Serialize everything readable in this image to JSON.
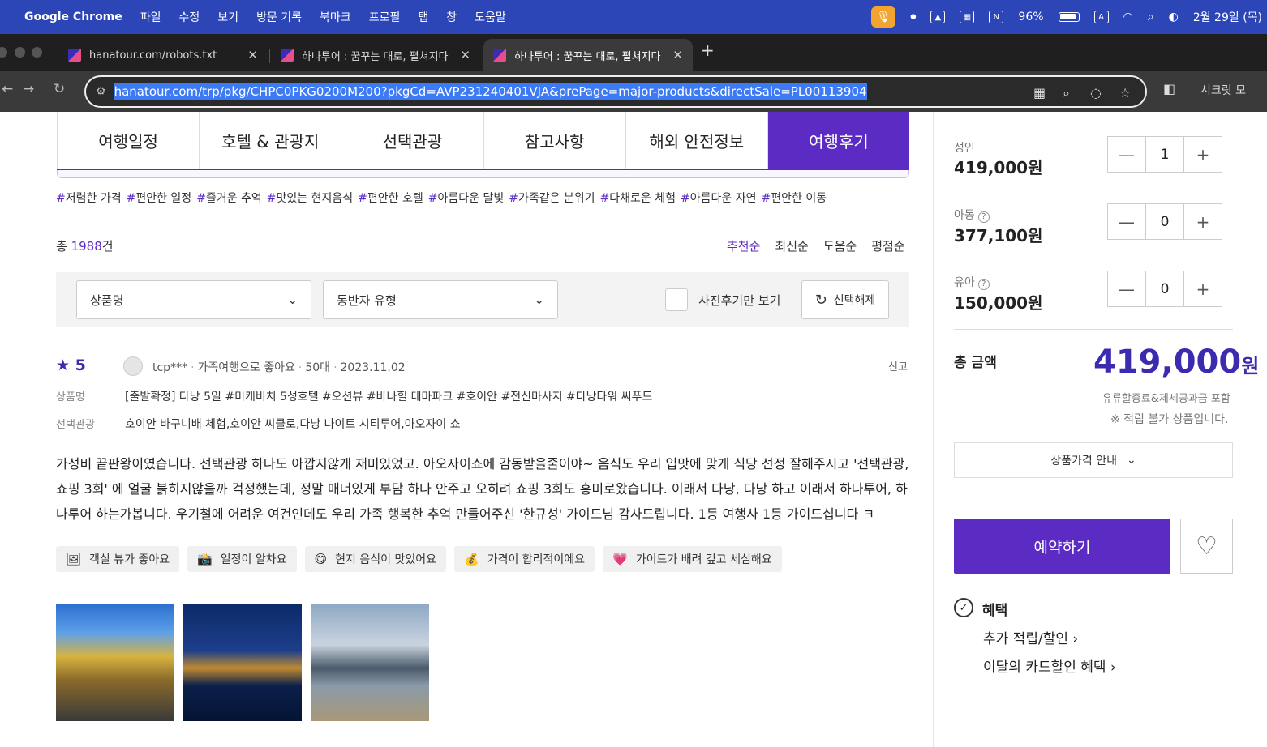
{
  "menubar": {
    "app": "Google Chrome",
    "items": [
      "파일",
      "수정",
      "보기",
      "방문 기록",
      "북마크",
      "프로필",
      "탭",
      "창",
      "도움말"
    ],
    "battery": "96%",
    "input_mode": "A",
    "datetime": "2월 29일 (목)"
  },
  "tabs": [
    {
      "title": "hanatour.com/robots.txt"
    },
    {
      "title": "하나투어 : 꿈꾸는 대로, 펼쳐지다"
    },
    {
      "title": "하나투어 : 꿈꾸는 대로, 펼쳐지다"
    }
  ],
  "address": {
    "url": "hanatour.com/trp/pkg/CHPC0PKG0200M200?pkgCd=AVP231240401VJA&prePage=major-products&directSale=PL00113904",
    "incognito_label": "시크릿 모"
  },
  "nav": [
    "여행일정",
    "호텔 & 관광지",
    "선택관광",
    "참고사항",
    "해외 안전정보",
    "여행후기"
  ],
  "tags": [
    "저렴한 가격",
    "편안한 일정",
    "즐거운 추억",
    "맛있는 현지음식",
    "편안한 호텔",
    "아름다운 달빛",
    "가족같은 분위기",
    "다채로운 체험",
    "아름다운 자연",
    "편안한 이동"
  ],
  "summary": {
    "total_prefix": "총 ",
    "total_count": "1988",
    "total_suffix": "건"
  },
  "sorts": [
    "추천순",
    "최신순",
    "도움순",
    "평점순"
  ],
  "filters": {
    "product": "상품명",
    "companion": "동반자 유형",
    "photo_only": "사진후기만 보기",
    "reset": "선택해제"
  },
  "review": {
    "rating": "5",
    "user": "tcp***",
    "type": "가족여행으로 좋아요",
    "age": "50대",
    "date": "2023.11.02",
    "report": "신고",
    "product_label": "상품명",
    "product": "[출발확정] 다낭 5일 #미케비치 5성호텔 #오션뷰 #바나힐 테마파크 #호이안 #전신마사지 #다낭타워 씨푸드",
    "option_label": "선택관광",
    "option": "호이안 바구니배 체험,호이안 씨클로,다낭 나이트 시티투어,아오자이 쇼",
    "text": "가성비 끝판왕이였습니다. 선택관광 하나도 아깝지않게 재미있었고. 아오자이쇼에 감동받을줄이야~ 음식도 우리 입맛에 맞게 식당 선정 잘해주시고 '선택관광, 쇼핑 3회' 에 얼굴 붉히지않을까 걱정했는데, 정말 매너있게 부담 하나 안주고 오히려 쇼핑 3회도 흥미로왔습니다. 이래서 다낭, 다낭 하고 이래서 하나투어, 하나투어 하는가봅니다. 우기철에 어려운 여건인데도 우리 가족 행복한 추억 만들어주신 '한규성' 가이드님 감사드립니다. 1등 여행사 1등 가이드십니다 ㅋ",
    "chips": [
      {
        "emoji": "🖼",
        "label": "객실 뷰가 좋아요"
      },
      {
        "emoji": "📸",
        "label": "일정이 알차요"
      },
      {
        "emoji": "😋",
        "label": "현지 음식이 맛있어요"
      },
      {
        "emoji": "💰",
        "label": "가격이 합리적이에요"
      },
      {
        "emoji": "💗",
        "label": "가이드가 배려 깊고 세심해요"
      }
    ]
  },
  "pricing": {
    "adult_label": "성인",
    "adult_price": "419,000원",
    "adult_qty": "1",
    "child_label": "아동",
    "child_price": "377,100원",
    "child_qty": "0",
    "infant_label": "유아",
    "infant_price": "150,000원",
    "infant_qty": "0",
    "help": "?",
    "total_label": "총 금액",
    "total_value": "419,000",
    "total_unit": "원",
    "fuel_note": "유류할증료&제세공과금 포함",
    "point_note": "※  적립 불가 상품입니다.",
    "price_info": "상품가격 안내",
    "book": "예약하기",
    "benefit": "혜택",
    "benefit_links": [
      "추가 적립/할인",
      "이달의 카드할인 혜택"
    ]
  },
  "colors": {
    "brand": "#5b2bc4",
    "menubar": "#2c46b8"
  }
}
